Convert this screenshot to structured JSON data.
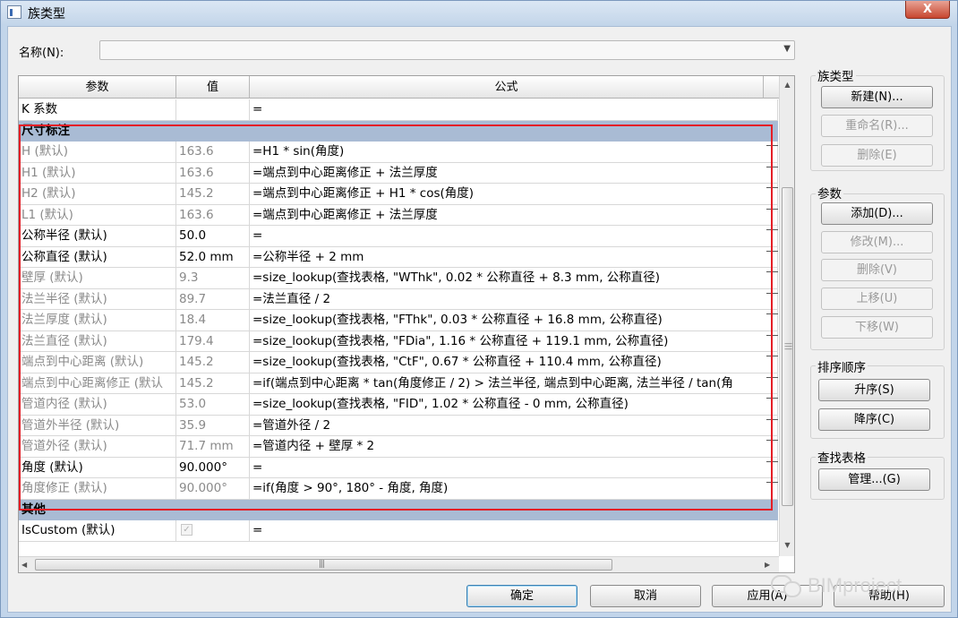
{
  "window": {
    "title": "族类型",
    "close_label": "X"
  },
  "name_field": {
    "label": "名称(N):",
    "value": ""
  },
  "grid": {
    "columns": [
      "参数",
      "值",
      "公式"
    ],
    "rows": [
      {
        "type": "row",
        "param": "K 系数",
        "value": "",
        "formula": "=",
        "gray": false
      },
      {
        "type": "group",
        "label": "尺寸标注"
      },
      {
        "type": "row",
        "param": "H (默认)",
        "value": "163.6",
        "formula": "=H1 * sin(角度)",
        "gray": true
      },
      {
        "type": "row",
        "param": "H1 (默认)",
        "value": "163.6",
        "formula": "=端点到中心距离修正 + 法兰厚度",
        "gray": true
      },
      {
        "type": "row",
        "param": "H2 (默认)",
        "value": "145.2",
        "formula": "=端点到中心距离修正 + H1 * cos(角度)",
        "gray": true
      },
      {
        "type": "row",
        "param": "L1 (默认)",
        "value": "163.6",
        "formula": "=端点到中心距离修正 + 法兰厚度",
        "gray": true
      },
      {
        "type": "row",
        "param": "公称半径 (默认)",
        "value": "50.0",
        "formula": "=",
        "gray": false
      },
      {
        "type": "row",
        "param": "公称直径 (默认)",
        "value": "52.0 mm",
        "formula": "=公称半径 + 2 mm",
        "gray": false
      },
      {
        "type": "row",
        "param": "壁厚 (默认)",
        "value": "9.3",
        "formula": "=size_lookup(查找表格, \"WThk\", 0.02 * 公称直径 + 8.3 mm, 公称直径)",
        "gray": true
      },
      {
        "type": "row",
        "param": "法兰半径 (默认)",
        "value": "89.7",
        "formula": "=法兰直径 / 2",
        "gray": true
      },
      {
        "type": "row",
        "param": "法兰厚度 (默认)",
        "value": "18.4",
        "formula": "=size_lookup(查找表格, \"FThk\", 0.03 * 公称直径 + 16.8 mm, 公称直径)",
        "gray": true
      },
      {
        "type": "row",
        "param": "法兰直径 (默认)",
        "value": "179.4",
        "formula": "=size_lookup(查找表格, \"FDia\", 1.16 * 公称直径 + 119.1 mm, 公称直径)",
        "gray": true
      },
      {
        "type": "row",
        "param": "端点到中心距离 (默认)",
        "value": "145.2",
        "formula": "=size_lookup(查找表格, \"CtF\", 0.67 * 公称直径 + 110.4 mm, 公称直径)",
        "gray": true
      },
      {
        "type": "row",
        "param": "端点到中心距离修正 (默认",
        "value": "145.2",
        "formula": "=if(端点到中心距离 * tan(角度修正 / 2) > 法兰半径, 端点到中心距离, 法兰半径 / tan(角",
        "gray": true
      },
      {
        "type": "row",
        "param": "管道内径 (默认)",
        "value": "53.0",
        "formula": "=size_lookup(查找表格, \"FID\", 1.02 * 公称直径 - 0 mm, 公称直径)",
        "gray": true
      },
      {
        "type": "row",
        "param": "管道外半径 (默认)",
        "value": "35.9",
        "formula": "=管道外径 / 2",
        "gray": true
      },
      {
        "type": "row",
        "param": "管道外径 (默认)",
        "value": "71.7 mm",
        "formula": "=管道内径 + 壁厚 * 2",
        "gray": true
      },
      {
        "type": "row",
        "param": "角度 (默认)",
        "value": "90.000°",
        "formula": "=",
        "gray": false
      },
      {
        "type": "row",
        "param": "角度修正 (默认)",
        "value": "90.000°",
        "formula": "=if(角度 > 90°, 180° - 角度, 角度)",
        "gray": true
      },
      {
        "type": "group",
        "label": "其他"
      },
      {
        "type": "row",
        "param": "IsCustom (默认)",
        "value": "",
        "formula": "=",
        "gray": false,
        "checkbox": true,
        "checked": true
      }
    ]
  },
  "right_panel": {
    "family_types": {
      "title": "族类型",
      "new": "新建(N)...",
      "rename": "重命名(R)...",
      "delete": "删除(E)"
    },
    "parameters": {
      "title": "参数",
      "add": "添加(D)...",
      "modify": "修改(M)...",
      "delete": "删除(V)",
      "move_up": "上移(U)",
      "move_down": "下移(W)"
    },
    "sort_order": {
      "title": "排序顺序",
      "ascending": "升序(S)",
      "descending": "降序(C)"
    },
    "lookup_tables": {
      "title": "查找表格",
      "manage": "管理...(G)"
    }
  },
  "footer": {
    "ok": "确定",
    "cancel": "取消",
    "apply": "应用(A)",
    "help": "帮助(H)"
  },
  "watermark": "BIMproject"
}
